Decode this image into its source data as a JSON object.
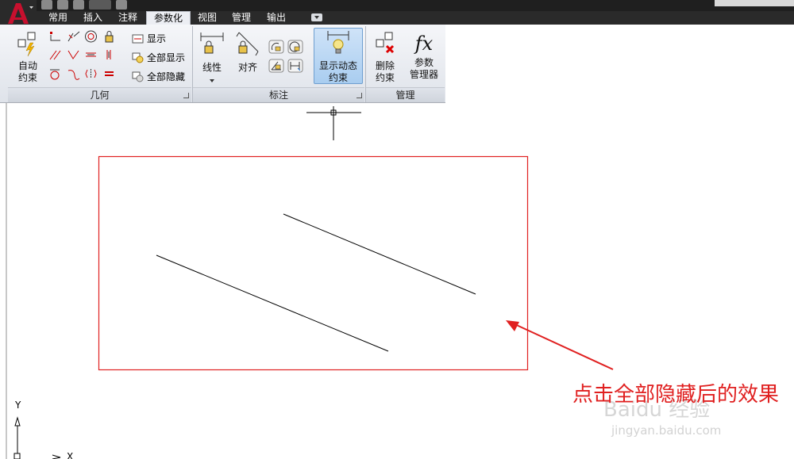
{
  "tabs": [
    {
      "label": "常用",
      "active": false
    },
    {
      "label": "插入",
      "active": false
    },
    {
      "label": "注释",
      "active": false
    },
    {
      "label": "参数化",
      "active": true
    },
    {
      "label": "视图",
      "active": false
    },
    {
      "label": "管理",
      "active": false
    },
    {
      "label": "输出",
      "active": false
    }
  ],
  "ribbon": {
    "geometry": {
      "panel_title": "几何",
      "auto_constrain": "自动\n约束",
      "show": "显示",
      "show_all": "全部显示",
      "hide_all": "全部隐藏"
    },
    "dimensional": {
      "panel_title": "标注",
      "linear": "线性",
      "aligned": "对齐",
      "show_dynamic": "显示动态\n约束"
    },
    "manage": {
      "panel_title": "管理",
      "delete_constraints": "删除\n约束",
      "param_manager": "参数\n管理器",
      "fx_glyph": "fx"
    }
  },
  "drawing": {
    "ucs_x": "X",
    "ucs_y": "Y"
  },
  "annotation_text": "点击全部隐藏后的效果",
  "watermark": {
    "brand": "Baidu 经验",
    "url": "jingyan.baidu.com"
  },
  "colors": {
    "accent_red": "#e02020",
    "active_button": "#a9cdf0",
    "tab_bar": "#2a2a2a"
  }
}
